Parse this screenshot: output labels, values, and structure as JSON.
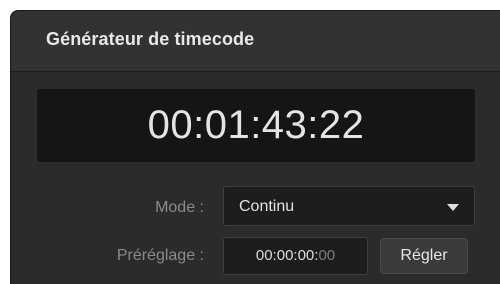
{
  "panel": {
    "title": "Générateur de timecode"
  },
  "timecode": {
    "value": "00:01:43:22"
  },
  "mode": {
    "label": "Mode :",
    "selected": "Continu"
  },
  "preset": {
    "label": "Préréglage :",
    "value_main": "00:00:00:",
    "value_frames": "00",
    "button_label": "Régler"
  },
  "icons": {
    "dropdown": "chevron-down-icon"
  },
  "colors": {
    "panel_background": "#2b2b2b",
    "header_background": "#323232",
    "display_background": "#151515",
    "label_text": "#8a8a8a",
    "value_text": "#e4e4e4"
  }
}
